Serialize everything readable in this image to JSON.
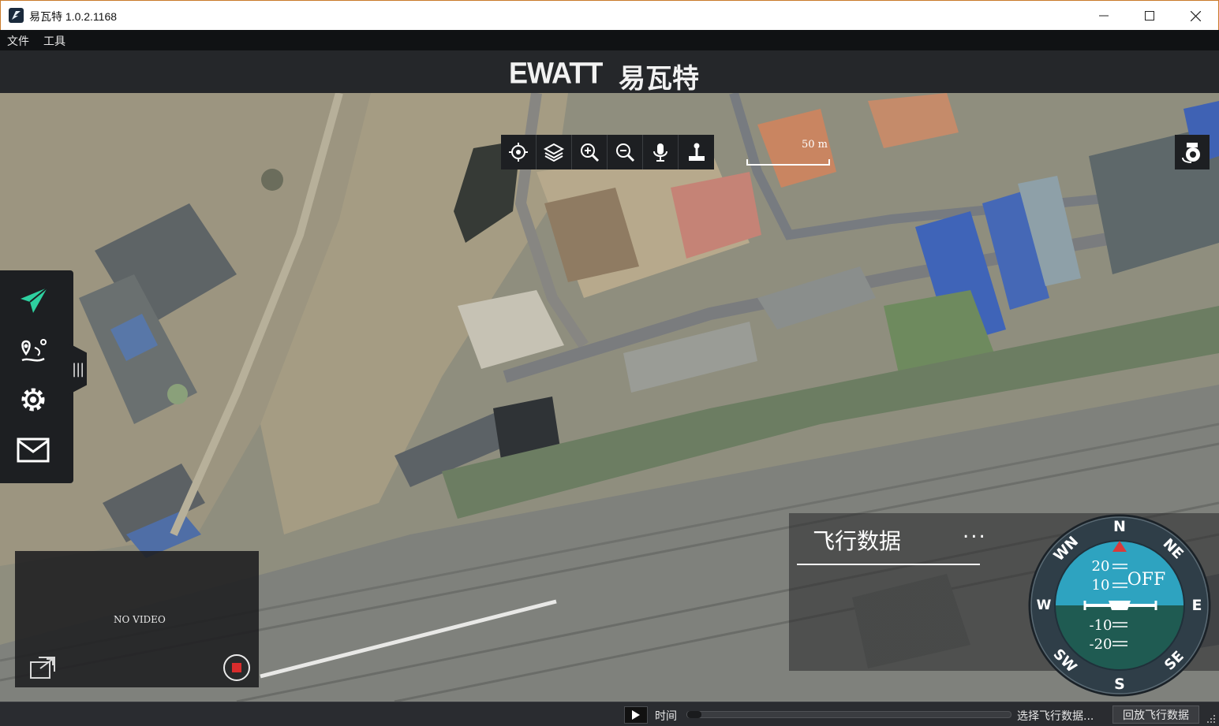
{
  "window": {
    "title": "易瓦特 1.0.2.1168",
    "app_icon": "ewatt-app-icon",
    "controls": [
      "minimize-icon",
      "maximize-icon",
      "close-icon"
    ]
  },
  "menu": {
    "items": [
      {
        "label": "文件"
      },
      {
        "label": "工具"
      }
    ]
  },
  "brand": {
    "latin": "EWATT",
    "cjk": "易瓦特"
  },
  "map_toolbar": {
    "tools": [
      {
        "icon": "locate-icon"
      },
      {
        "icon": "layers-icon"
      },
      {
        "icon": "zoom-in-icon"
      },
      {
        "icon": "zoom-out-icon"
      },
      {
        "icon": "microphone-icon"
      },
      {
        "icon": "joystick-icon"
      }
    ]
  },
  "scale": {
    "label": "50 m"
  },
  "sidebar": {
    "items": [
      {
        "icon": "send-plane-icon",
        "active": true
      },
      {
        "icon": "route-waypoint-icon"
      },
      {
        "icon": "settings-gear-icon"
      },
      {
        "icon": "mail-envelope-icon"
      }
    ],
    "handle_label": "|||"
  },
  "video": {
    "status": "NO VIDEO"
  },
  "flight_panel": {
    "title": "飞行数据",
    "more": "..."
  },
  "compass": {
    "cardinals": {
      "n": "N",
      "e": "E",
      "s": "S",
      "w": "W"
    },
    "intercardinals": {
      "ne": "NE",
      "se": "SE",
      "sw": "SW",
      "nw": "WN"
    },
    "pitch_labels": {
      "p20": "20",
      "p10": "10",
      "m10": "-10",
      "m20": "-20"
    },
    "mode": "OFF",
    "colors": {
      "sky": "#2ea3c0",
      "ground": "#1f5b52",
      "ring": "#31404a",
      "heading_marker": "#d93a3a"
    }
  },
  "status_bar": {
    "time_label": "时间",
    "progress": 0,
    "select_data": "选择飞行数据...",
    "replay_button": "回放飞行数据"
  }
}
